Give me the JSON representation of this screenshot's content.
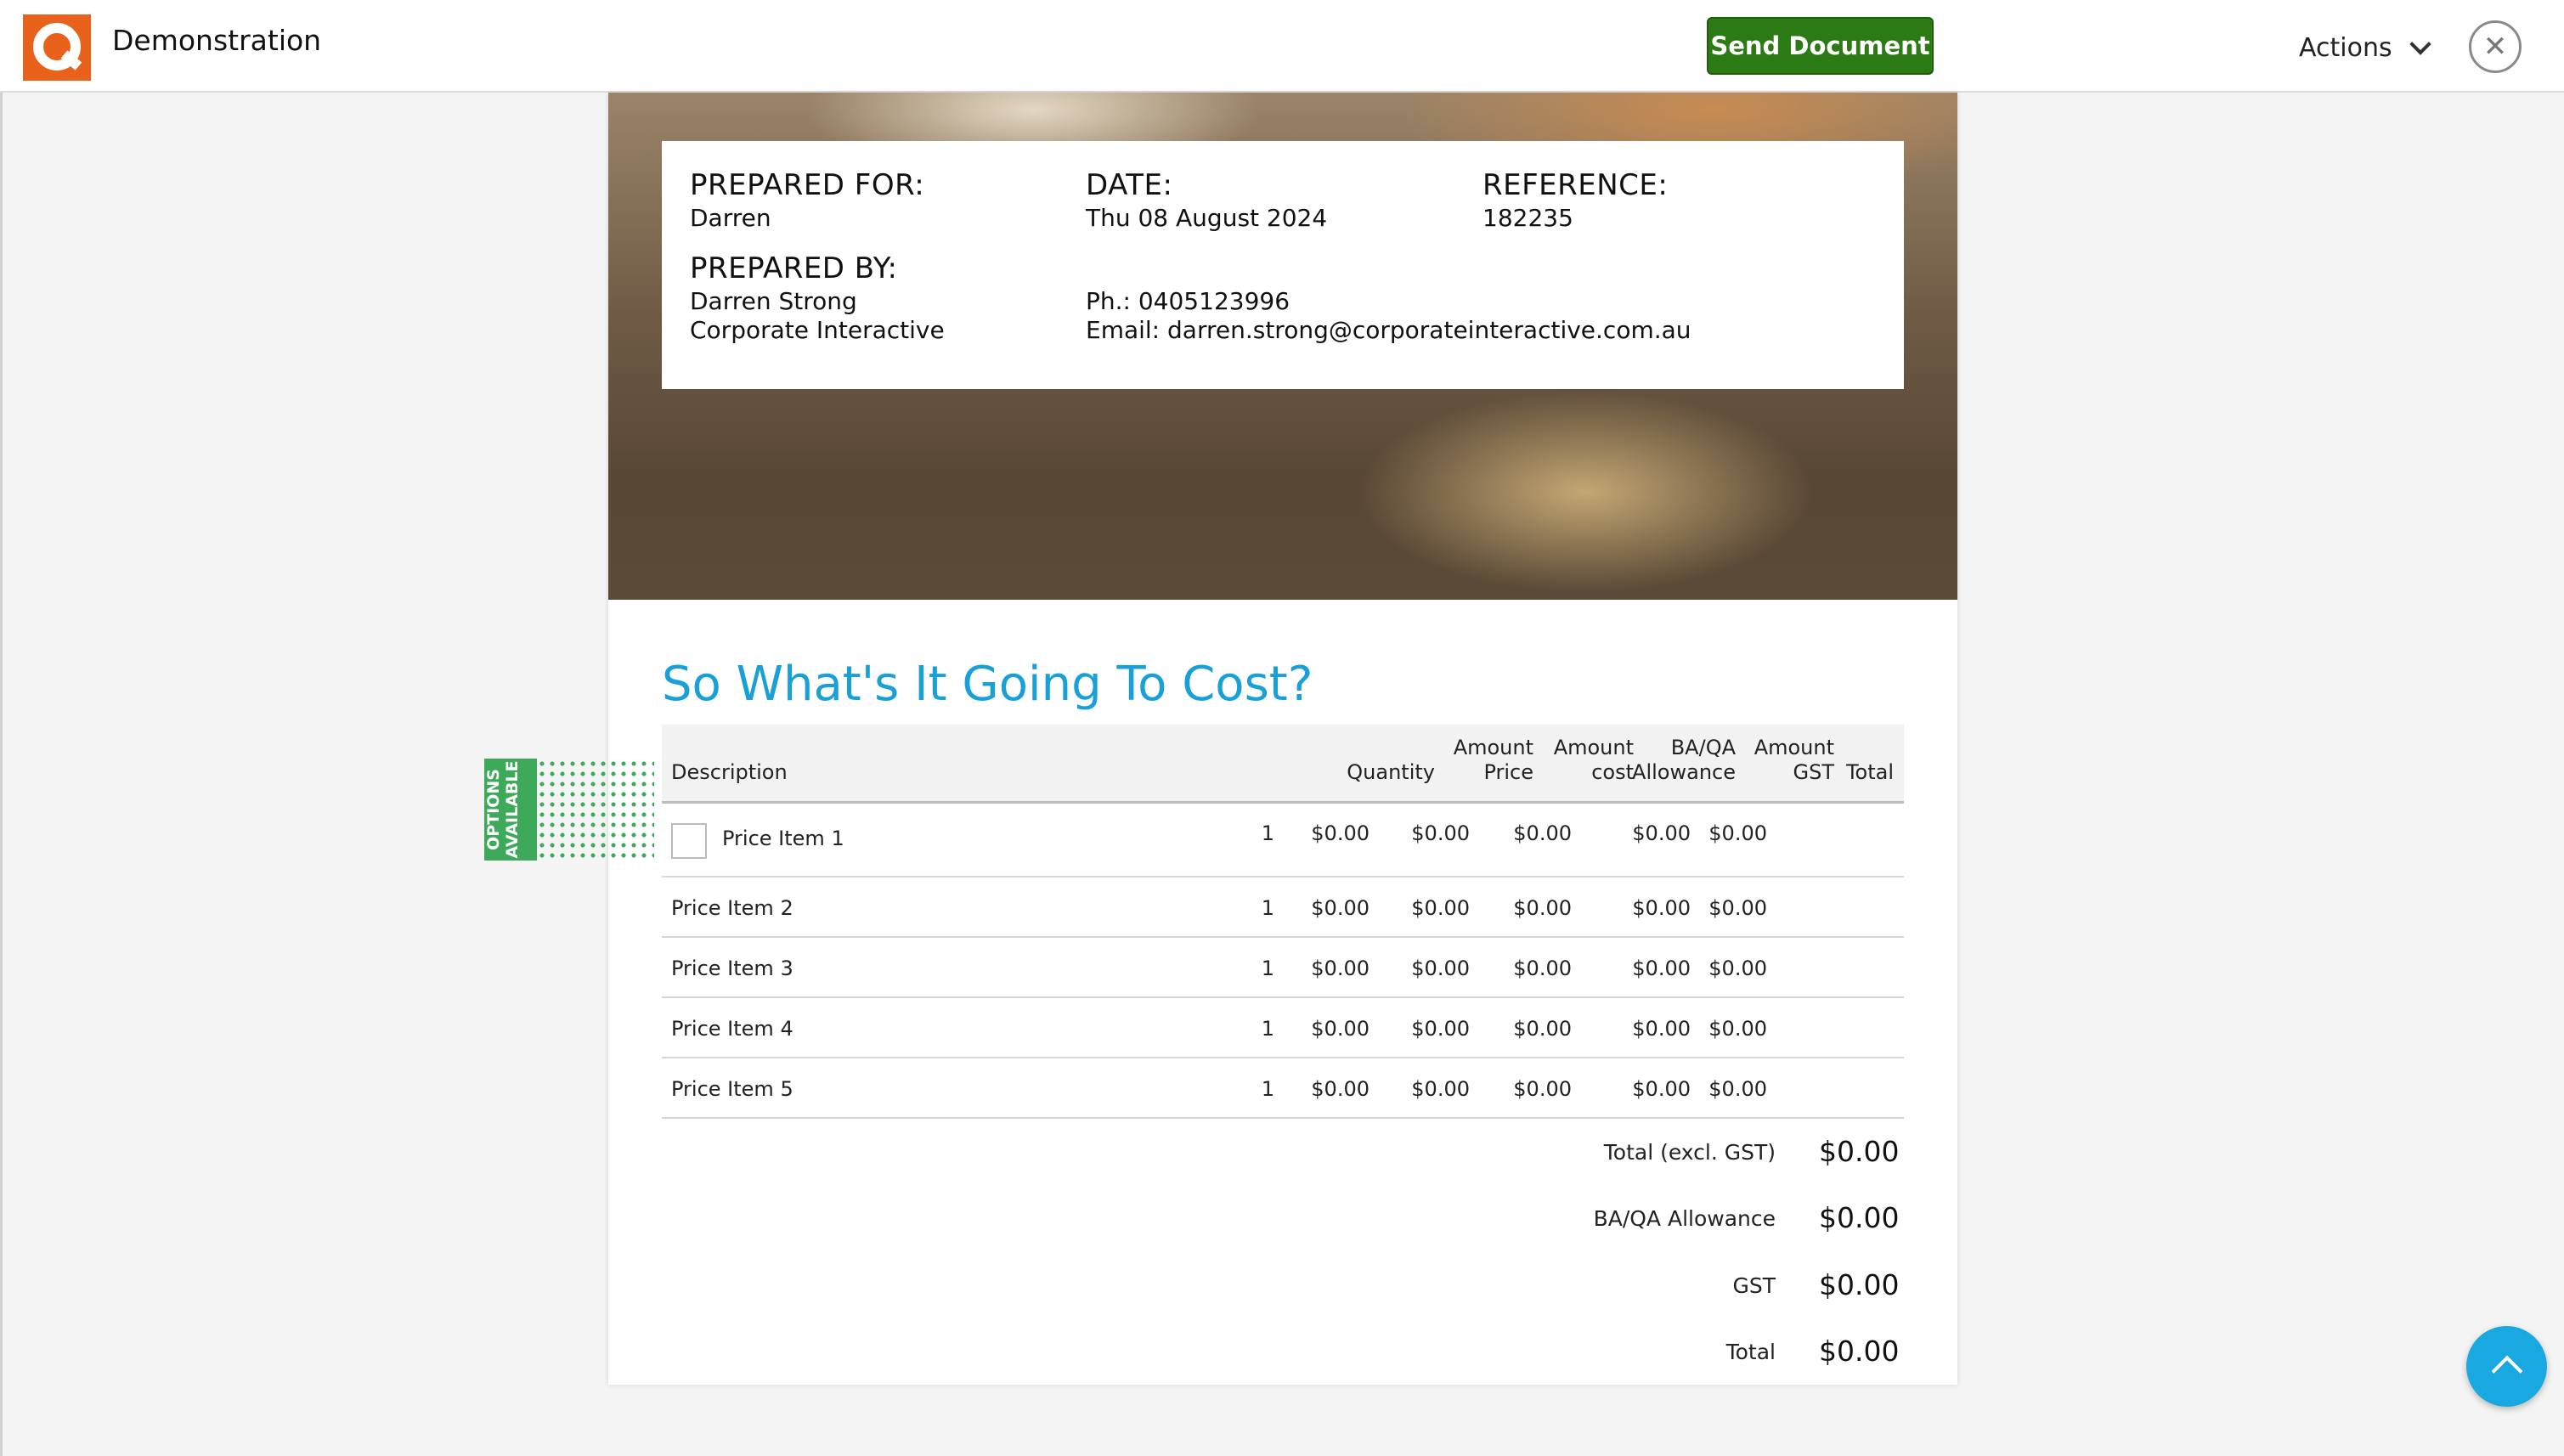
{
  "app": {
    "title": "Demonstration",
    "send_label": "Send Document",
    "actions_label": "Actions",
    "close_glyph": "✕"
  },
  "info": {
    "prepared_for_label": "PREPARED FOR:",
    "prepared_for": "Darren",
    "date_label": "DATE:",
    "date": "Thu 08 August 2024",
    "reference_label": "REFERENCE:",
    "reference": "182235",
    "prepared_by_label": "PREPARED BY:",
    "prepared_by_name": "Darren Strong",
    "prepared_by_company": "Corporate Interactive",
    "phone": "Ph.: 0405123996",
    "email": "Email: darren.strong@corporateinteractive.com.au"
  },
  "cost": {
    "title": "So What's It Going To Cost?",
    "options_line1": "OPTIONS",
    "options_line2": "AVAILABLE",
    "headers": {
      "description": "Description",
      "quantity": "Quantity",
      "amount_price_1": "Amount",
      "amount_price_2": "Price",
      "amount_cost_1": "Amount",
      "amount_cost_2": "cost",
      "baqa_1": "BA/QA",
      "baqa_2": "Allowance",
      "gst_1": "Amount",
      "gst_2": "GST",
      "total": "Total"
    },
    "rows": [
      {
        "description": "Price Item 1",
        "quantity": "1",
        "price": "$0.00",
        "cost": "$0.00",
        "allowance": "$0.00",
        "gst": "$0.00",
        "total": "$0.00"
      },
      {
        "description": "Price Item 2",
        "quantity": "1",
        "price": "$0.00",
        "cost": "$0.00",
        "allowance": "$0.00",
        "gst": "$0.00",
        "total": "$0.00"
      },
      {
        "description": "Price Item 3",
        "quantity": "1",
        "price": "$0.00",
        "cost": "$0.00",
        "allowance": "$0.00",
        "gst": "$0.00",
        "total": "$0.00"
      },
      {
        "description": "Price Item 4",
        "quantity": "1",
        "price": "$0.00",
        "cost": "$0.00",
        "allowance": "$0.00",
        "gst": "$0.00",
        "total": "$0.00"
      },
      {
        "description": "Price Item 5",
        "quantity": "1",
        "price": "$0.00",
        "cost": "$0.00",
        "allowance": "$0.00",
        "gst": "$0.00",
        "total": "$0.00"
      }
    ],
    "totals": [
      {
        "label": "Total (excl. GST)",
        "value": "$0.00"
      },
      {
        "label": "BA/QA Allowance",
        "value": "$0.00"
      },
      {
        "label": "GST",
        "value": "$0.00"
      },
      {
        "label": "Total",
        "value": "$0.00"
      }
    ]
  },
  "colors": {
    "accent": "#1aa0d8",
    "send_button": "#2b7a14",
    "options_badge": "#3daa5a",
    "logo": "#e8621b"
  },
  "icons": {
    "logo": "q-logo-icon",
    "actions": "chevron-down-icon",
    "close": "close-icon",
    "scroll_top": "chevron-up-icon"
  }
}
